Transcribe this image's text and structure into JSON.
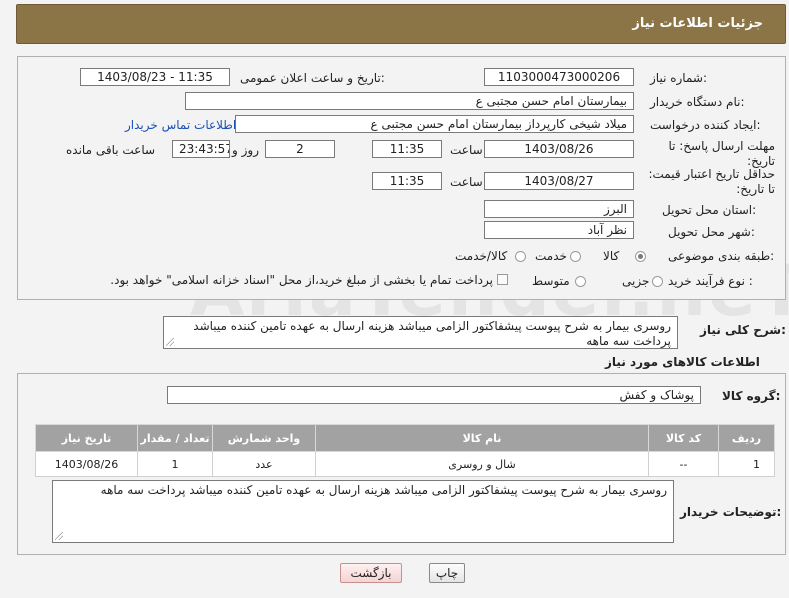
{
  "header": {
    "title": "جزئیات اطلاعات نیاز"
  },
  "form": {
    "need_number_label": "شماره نیاز:",
    "need_number": "1103000473000206",
    "announce_label": "تاریخ و ساعت اعلان عمومی:",
    "announce_value": "1403/08/23 - 11:35",
    "buyer_label": "نام دستگاه خریدار:",
    "buyer_value": "بیمارستان امام حسن مجتبی ع",
    "creator_label": "ایجاد کننده درخواست:",
    "creator_value": "میلاد شیخی کارپرداز بیمارستان امام حسن مجتبی ع",
    "contact_link": "اطلاعات تماس خریدار",
    "deadline_label": "مهلت ارسال پاسخ: تا تاریخ:",
    "deadline_date": "1403/08/26",
    "time_label": "ساعت",
    "deadline_time": "11:35",
    "days_value": "2",
    "days_label": "روز و",
    "remaining_value": "23:43:57",
    "remaining_label": "ساعت باقی مانده",
    "validity_label": "حداقل تاریخ اعتبار قیمت: تا تاریخ:",
    "validity_date": "1403/08/27",
    "validity_time": "11:35",
    "province_label": "استان محل تحویل:",
    "province_value": "البرز",
    "city_label": "شهر محل تحویل:",
    "city_value": "نظر آباد",
    "category_label": "طبقه بندی موضوعی:",
    "category_options": [
      "کالا",
      "خدمت",
      "کالا/خدمت"
    ],
    "category_selected": "کالا",
    "process_label": "نوع فرآیند خرید :",
    "process_options": [
      "جزیی",
      "متوسط"
    ],
    "payment_note": "پرداخت تمام یا بخشی از مبلغ خرید،از محل \"اسناد خزانه اسلامی\" خواهد بود."
  },
  "description": {
    "label": "شرح کلی نیاز:",
    "value": "روسری بیمار به شرح پیوست پیشفاکتور الزامی میباشد هزینه ارسال به عهده تامین کننده میباشد پرداخت سه ماهه"
  },
  "goods": {
    "section_title": "اطلاعات کالاهای مورد نیاز",
    "group_label": "گروه کالا:",
    "group_value": "پوشاک و کفش",
    "columns": [
      "ردیف",
      "کد کالا",
      "نام کالا",
      "واحد شمارش",
      "تعداد / مقدار",
      "تاریخ نیاز"
    ],
    "rows": [
      {
        "row": "1",
        "code": "--",
        "name": "شال و روسری",
        "unit": "عدد",
        "qty": "1",
        "date": "1403/08/26"
      }
    ]
  },
  "buyer_notes": {
    "label": "توضیحات خریدار:",
    "value": "روسری بیمار به شرح پیوست پیشفاکتور الزامی میباشد هزینه ارسال به عهده تامین کننده میباشد پرداخت سه ماهه"
  },
  "buttons": {
    "print": "چاپ",
    "back": "بازگشت"
  },
  "colors": {
    "header": "#8b7547",
    "table_header": "#a2a2a2",
    "link": "#1a4fb5"
  }
}
